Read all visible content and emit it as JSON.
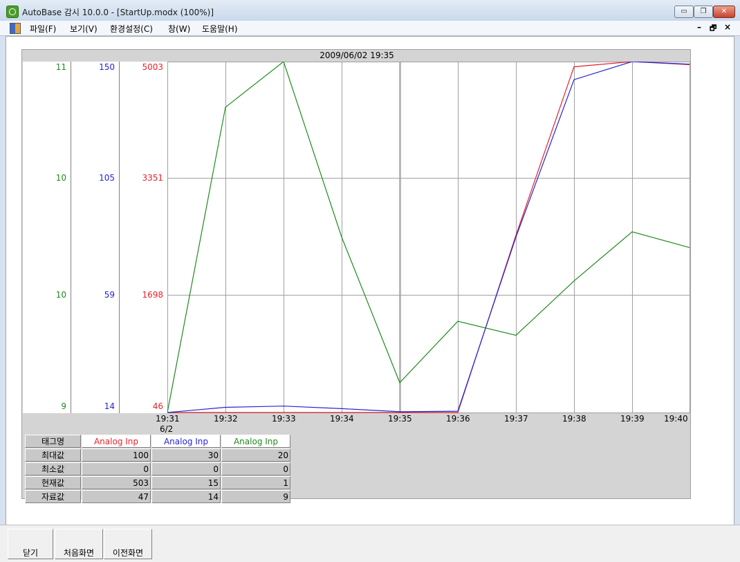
{
  "window": {
    "title": "AutoBase 감시 10.0.0 - [StartUp.modx (100%)]"
  },
  "window_controls": {
    "minimize": "▭",
    "restore": "❐",
    "close": "✕"
  },
  "menu": {
    "items": [
      "파일(F)",
      "보기(V)",
      "환경설정(C)",
      "창(W)",
      "도움말(H)"
    ]
  },
  "mdi_controls": {
    "minimize": "–",
    "restore": "🗗",
    "close": "×"
  },
  "colors": {
    "red": "#e8202a",
    "blue": "#2323d8",
    "green": "#1e8a1e"
  },
  "trend": {
    "datetime": "2009/06/02 19:35",
    "date_label": "6/2",
    "green_axis": [
      "11",
      "10",
      "10",
      "9"
    ],
    "blue_axis": [
      "150",
      "105",
      "59",
      "14"
    ],
    "red_axis": [
      "5003",
      "3351",
      "1698",
      "46"
    ],
    "x_ticks": [
      "19:31",
      "19:32",
      "19:33",
      "19:34",
      "19:35",
      "19:36",
      "19:37",
      "19:38",
      "19:39",
      "19:40"
    ]
  },
  "chart_data": {
    "type": "line",
    "x": [
      "19:31",
      "19:32",
      "19:33",
      "19:34",
      "19:35",
      "19:36",
      "19:37",
      "19:38",
      "19:39",
      "19:40"
    ],
    "series": [
      {
        "name": "Analog Inp",
        "color": "#e8202a",
        "ylim": [
          46,
          5003
        ],
        "values": [
          46,
          46,
          46,
          46,
          46,
          46,
          2550,
          4930,
          5003,
          4960
        ]
      },
      {
        "name": "Analog Inp",
        "color": "#2323d8",
        "ylim": [
          14,
          150
        ],
        "values": [
          14,
          16,
          16.5,
          15.5,
          14.3,
          14.5,
          82,
          143,
          150,
          149
        ]
      },
      {
        "name": "Analog Inp",
        "color": "#1e8a1e",
        "ylim": [
          9,
          11
        ],
        "values": [
          9,
          10.74,
          11,
          10.0,
          9.17,
          9.52,
          9.44,
          9.75,
          10.03,
          9.94
        ]
      }
    ]
  },
  "info_table": {
    "rows": [
      {
        "label": "태그명",
        "values": [
          "Analog Inp",
          "Analog Inp",
          "Analog Inp"
        ]
      },
      {
        "label": "최대값",
        "values": [
          "100",
          "30",
          "20"
        ]
      },
      {
        "label": "최소값",
        "values": [
          "0",
          "0",
          "0"
        ]
      },
      {
        "label": "현재값",
        "values": [
          "503",
          "15",
          "1"
        ]
      },
      {
        "label": "자료값",
        "values": [
          "47",
          "14",
          "9"
        ]
      }
    ]
  },
  "buttons": {
    "close": "닫기",
    "home": "처음화면",
    "previous": "이전화면"
  }
}
